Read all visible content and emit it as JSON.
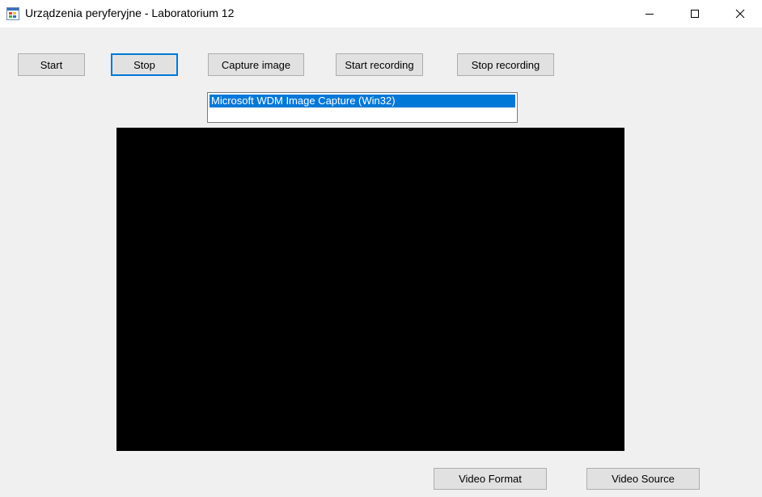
{
  "window": {
    "title": "Urządzenia peryferyjne - Laboratorium 12",
    "icon": "form-icon"
  },
  "toolbar": {
    "start_label": "Start",
    "stop_label": "Stop",
    "capture_image_label": "Capture image",
    "start_recording_label": "Start recording",
    "stop_recording_label": "Stop recording"
  },
  "device_list": {
    "items": [
      "Microsoft WDM Image Capture (Win32)"
    ],
    "selected": "Microsoft WDM Image Capture (Win32)"
  },
  "bottom": {
    "video_format_label": "Video Format",
    "video_source_label": "Video Source"
  },
  "colors": {
    "selection": "#0078d7",
    "preview_background": "#000000"
  }
}
